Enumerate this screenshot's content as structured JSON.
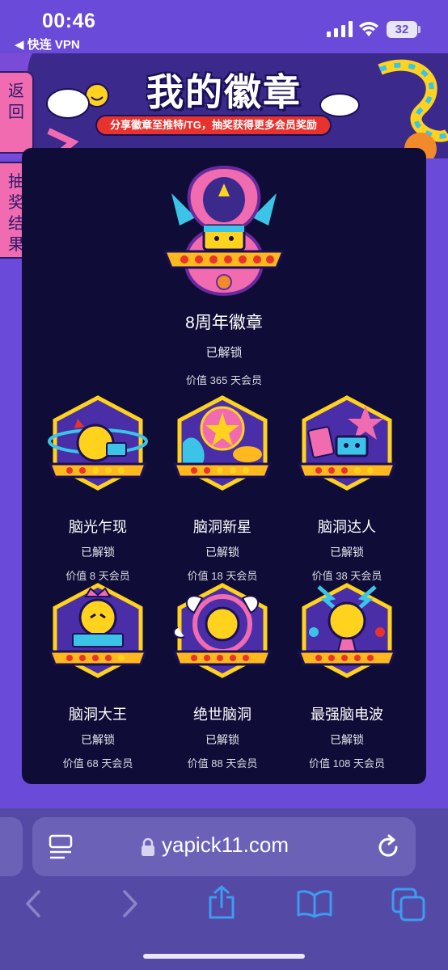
{
  "status_bar": {
    "time": "00:46",
    "back_app": "◀ 快连 VPN",
    "battery": "32"
  },
  "header": {
    "title": "我的徽章",
    "subtitle": "分享徽章至推特/TG，抽奖获得更多会员奖励"
  },
  "side_tabs": {
    "back": [
      "返",
      "回"
    ],
    "lottery": [
      "抽",
      "奖",
      "结",
      "果"
    ]
  },
  "featured_badge": {
    "name": "8周年徽章",
    "status": "已解锁",
    "value": "价值 365 天会员"
  },
  "badges": [
    {
      "name": "脑光乍现",
      "status": "已解锁",
      "value": "价值 8 天会员"
    },
    {
      "name": "脑洞新星",
      "status": "已解锁",
      "value": "价值 18 天会员"
    },
    {
      "name": "脑洞达人",
      "status": "已解锁",
      "value": "价值 38 天会员"
    },
    {
      "name": "脑洞大王",
      "status": "已解锁",
      "value": "价值 68 天会员"
    },
    {
      "name": "绝世脑洞",
      "status": "已解锁",
      "value": "价值 88 天会员"
    },
    {
      "name": "最强脑电波",
      "status": "已解锁",
      "value": "价值 108 天会员"
    }
  ],
  "browser": {
    "url": "yapick11.com"
  },
  "colors": {
    "page_background": "#6a4ad8",
    "panel_background": "#0f0d37",
    "side_tab": "#f06bb0",
    "subtitle_pill": "#e8322e"
  }
}
